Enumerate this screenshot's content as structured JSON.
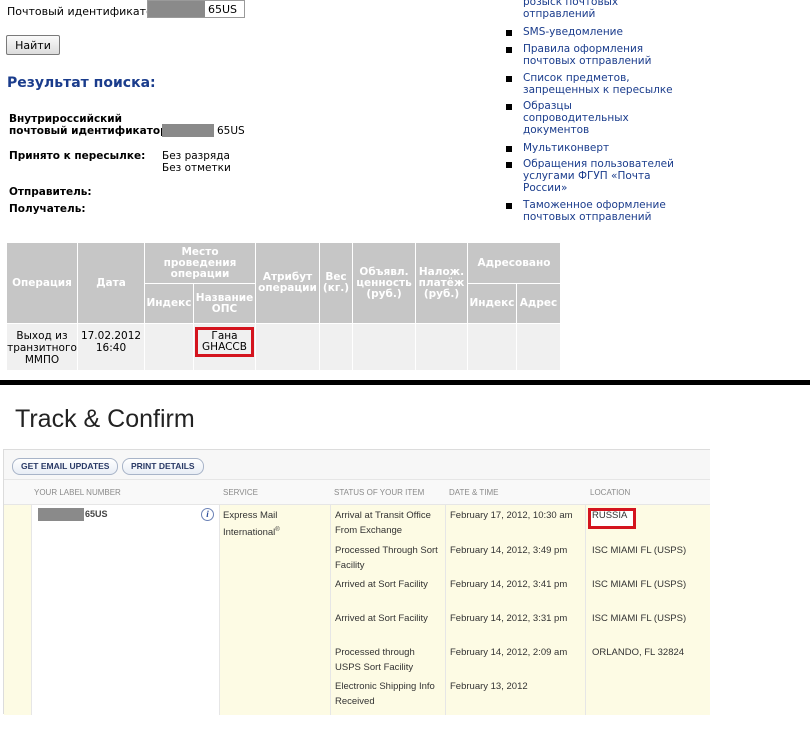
{
  "ru": {
    "id_label": "Почтовый идентификатор:",
    "id_value_suffix": "65US",
    "find_button": "Найти",
    "result_title": "Результат поиска:",
    "domestic_id_label_line1": "Внутрироссийский",
    "domestic_id_label_line2": "почтовый идентификатор:",
    "domestic_id_suffix": "65US",
    "accepted_label": "Принято к пересылке:",
    "accepted_value_line1": "Без разряда",
    "accepted_value_line2": "Без отметки",
    "sender_label": "Отправитель:",
    "recipient_label": "Получатель:",
    "links": [
      {
        "lines": [
          "розыск почтовых",
          "отправлений"
        ]
      },
      {
        "lines": [
          "SMS-уведомление"
        ]
      },
      {
        "lines": [
          "Правила оформления",
          "почтовых отправлений"
        ]
      },
      {
        "lines": [
          "Список предметов,",
          "запрещенных к пересылке"
        ]
      },
      {
        "lines": [
          "Образцы",
          "сопроводительных",
          "документов"
        ]
      },
      {
        "lines": [
          "Мультиконверт"
        ]
      },
      {
        "lines": [
          "Обращения пользователей",
          "услугами ФГУП «Почта",
          "России»"
        ]
      },
      {
        "lines": [
          "Таможенное оформление",
          "почтовых отправлений"
        ]
      }
    ],
    "table": {
      "h_operation": "Операция",
      "h_date": "Дата",
      "h_place_l1": "Место",
      "h_place_l2": "проведения",
      "h_place_l3": "операции",
      "h_index": "Индекс",
      "h_ops_l1": "Название",
      "h_ops_l2": "ОПС",
      "h_attr_l1": "Атрибут",
      "h_attr_l2": "операции",
      "h_weight_l1": "Вес",
      "h_weight_l2": "(кг.)",
      "h_value_l1": "Объявл.",
      "h_value_l2": "ценность",
      "h_value_l3": "(руб.)",
      "h_cod_l1": "Налож.",
      "h_cod_l2": "платёж",
      "h_cod_l3": "(руб.)",
      "h_addressed": "Адресовано",
      "h_addr_index": "Индекс",
      "h_addr_address": "Адрес",
      "row": {
        "op_l1": "Выход из",
        "op_l2": "транзитного",
        "op_l3": "ММПО",
        "date_l1": "17.02.2012",
        "date_l2": "16:40",
        "ops_l1": "Гана",
        "ops_l2": "GHACCB"
      }
    }
  },
  "usps": {
    "title": "Track & Confirm",
    "btn_email": "GET EMAIL UPDATES",
    "btn_print": "PRINT DETAILS",
    "col_label": "YOUR LABEL NUMBER",
    "col_service": "SERVICE",
    "col_status": "STATUS OF YOUR ITEM",
    "col_datetime": "DATE & TIME",
    "col_location": "LOCATION",
    "label_suffix": "65US",
    "info_icon": "i",
    "service_l1": "Express Mail",
    "service_l2": "International",
    "service_mark": "®",
    "events": [
      {
        "status_l1": "Arrival at Transit Office",
        "status_l2": "From Exchange",
        "datetime": "February 17, 2012, 10:30 am",
        "location": "RUSSIA"
      },
      {
        "status_l1": "Processed Through Sort",
        "status_l2": "Facility",
        "datetime": "February 14, 2012, 3:49 pm",
        "location": "ISC MIAMI FL (USPS)"
      },
      {
        "status_l1": "Arrived at Sort Facility",
        "status_l2": "",
        "datetime": "February 14, 2012, 3:41 pm",
        "location": "ISC MIAMI FL (USPS)"
      },
      {
        "status_l1": "Arrived at Sort Facility",
        "status_l2": "",
        "datetime": "February 14, 2012, 3:31 pm",
        "location": "ISC MIAMI FL (USPS)"
      },
      {
        "status_l1": "Processed through",
        "status_l2": "USPS Sort Facility",
        "datetime": "February 14, 2012, 2:09 am",
        "location": "ORLANDO, FL 32824"
      },
      {
        "status_l1": "Electronic Shipping Info",
        "status_l2": "Received",
        "datetime": "February 13, 2012",
        "location": ""
      }
    ]
  }
}
